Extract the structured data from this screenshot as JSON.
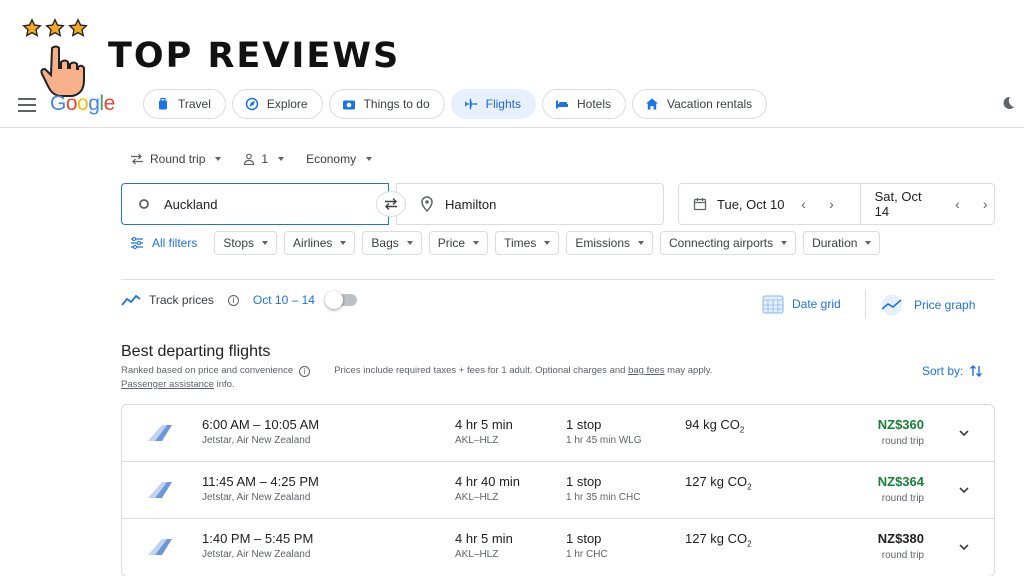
{
  "banner": {
    "title": "TOP REVIEWS"
  },
  "nav": {
    "logo": {
      "letters": [
        "G",
        "o",
        "o",
        "g",
        "l",
        "e"
      ]
    },
    "chips": [
      {
        "label": "Travel",
        "icon": "suitcase-icon"
      },
      {
        "label": "Explore",
        "icon": "explore-icon"
      },
      {
        "label": "Things to do",
        "icon": "camera-icon"
      },
      {
        "label": "Flights",
        "icon": "airplane-icon",
        "active": true
      },
      {
        "label": "Hotels",
        "icon": "bed-icon"
      },
      {
        "label": "Vacation rentals",
        "icon": "home-icon"
      }
    ]
  },
  "search": {
    "trip_type": "Round trip",
    "passengers": "1",
    "cabin": "Economy",
    "from": "Auckland",
    "to": "Hamilton",
    "depart_date": "Tue, Oct 10",
    "return_date": "Sat, Oct 14"
  },
  "filters": {
    "all_filters": "All filters",
    "items": [
      "Stops",
      "Airlines",
      "Bags",
      "Price",
      "Times",
      "Emissions",
      "Connecting airports",
      "Duration"
    ]
  },
  "track": {
    "label": "Track prices",
    "dates": "Oct 10 – 14",
    "date_grid": "Date grid",
    "price_graph": "Price graph"
  },
  "results": {
    "title": "Best departing flights",
    "ranked_note": "Ranked based on price and convenience",
    "price_note_a": "Prices include required taxes + fees for 1 adult. Optional charges and ",
    "bag_fees": "bag fees",
    "price_note_b": " may apply.",
    "passenger_assistance": "Passenger assistance",
    "info_suffix": " info.",
    "sort_by": "Sort by:",
    "flights": [
      {
        "times": "6:00 AM – 10:05 AM",
        "airline": "Jetstar, Air New Zealand",
        "duration": "4 hr 5 min",
        "route": "AKL–HLZ",
        "stops": "1 stop",
        "layover": "1 hr 45 min WLG",
        "co2": "94 kg CO",
        "price": "NZ$360",
        "price_note": "round trip"
      },
      {
        "times": "11:45 AM – 4:25 PM",
        "airline": "Jetstar, Air New Zealand",
        "duration": "4 hr 40 min",
        "route": "AKL–HLZ",
        "stops": "1 stop",
        "layover": "1 hr 35 min CHC",
        "co2": "127 kg CO",
        "price": "NZ$364",
        "price_note": "round trip"
      },
      {
        "times": "1:40 PM – 5:45 PM",
        "airline": "Jetstar, Air New Zealand",
        "duration": "4 hr 5 min",
        "route": "AKL–HLZ",
        "stops": "1 stop",
        "layover": "1 hr CHC",
        "co2": "127 kg CO",
        "price": "NZ$380",
        "price_note": "round trip"
      }
    ]
  },
  "colors": {
    "accent": "#1a73e8",
    "price_green": "#188038",
    "active_chip_bg": "#e8f0fe"
  }
}
